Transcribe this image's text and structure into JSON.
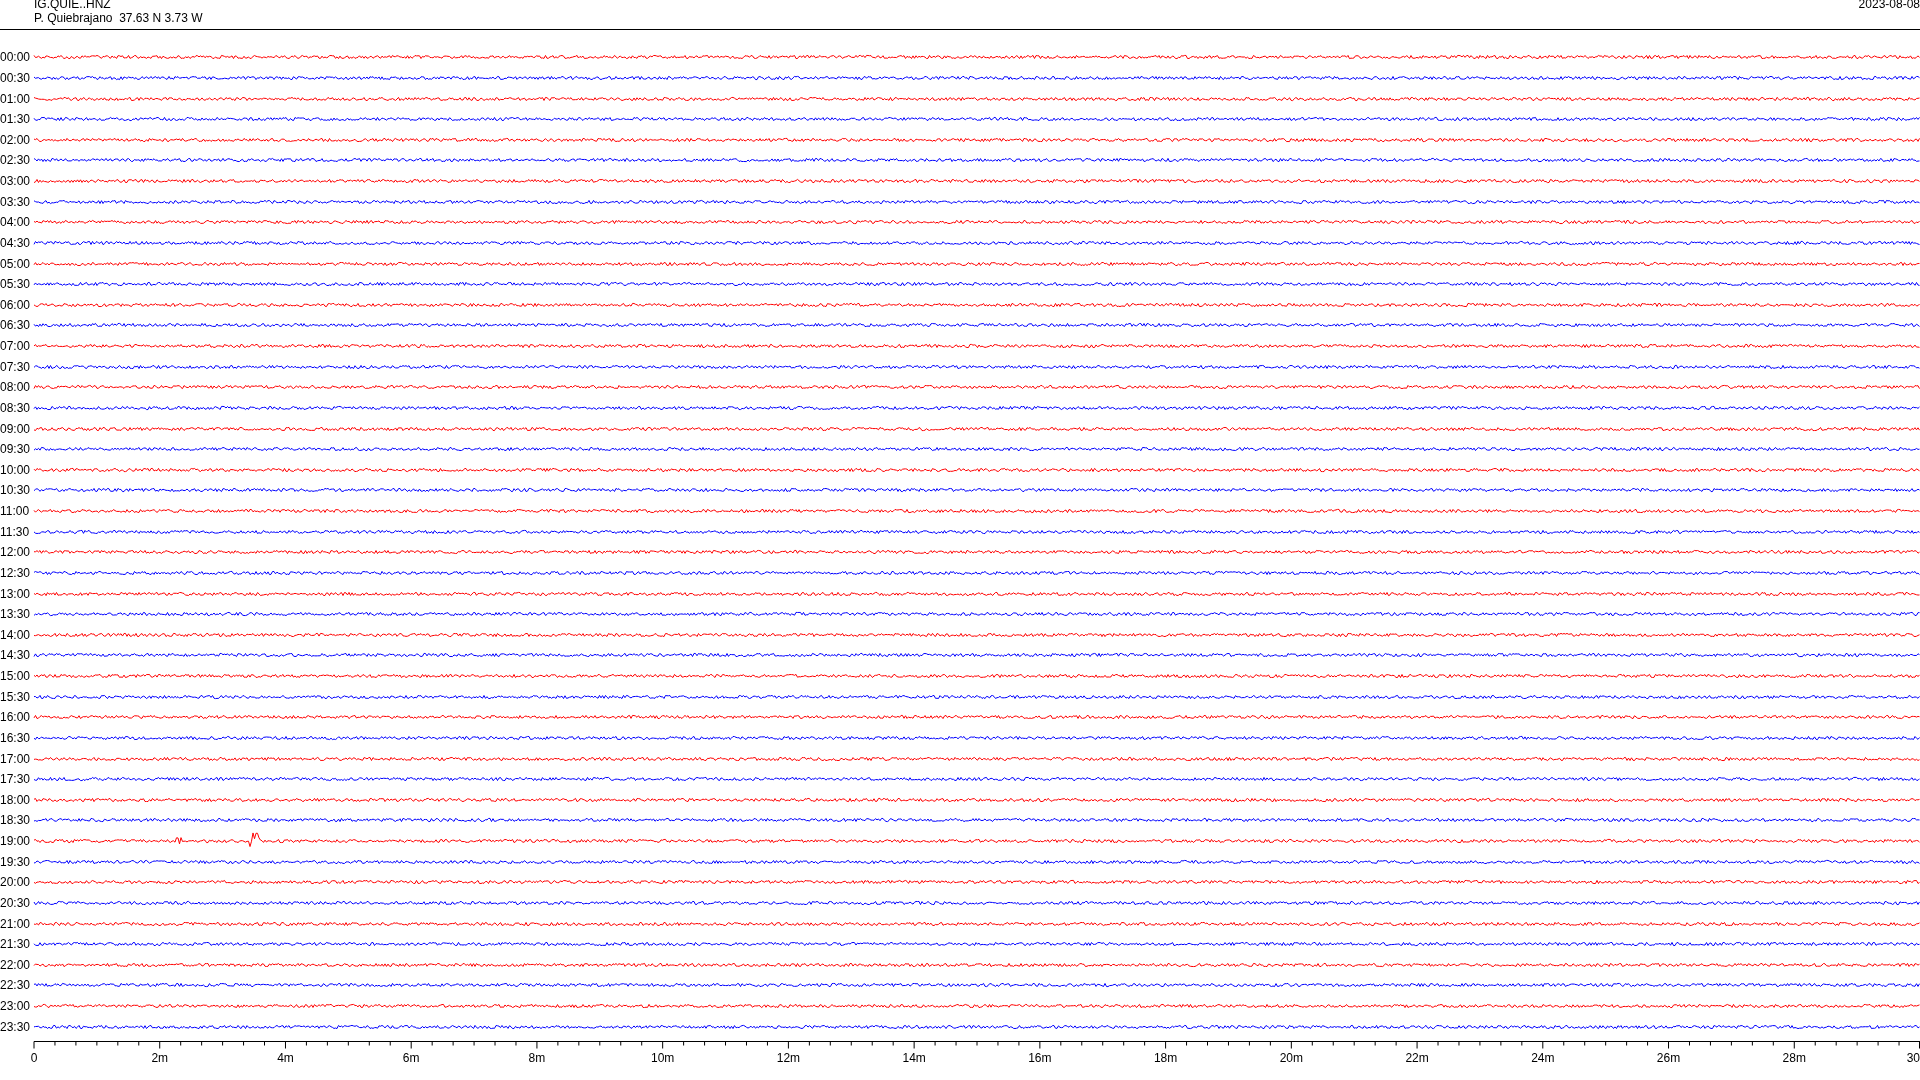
{
  "header": {
    "channel": "IG.QUIE..HNZ",
    "station": "P. Quiebrajano  37.63 N 3.73 W",
    "date": "2023-08-08"
  },
  "traces": [
    {
      "label": "00:00",
      "color": "#ff0000",
      "event": false
    },
    {
      "label": "00:30",
      "color": "#0000ff",
      "event": false
    },
    {
      "label": "01:00",
      "color": "#ff0000",
      "event": false
    },
    {
      "label": "01:30",
      "color": "#0000ff",
      "event": false
    },
    {
      "label": "02:00",
      "color": "#ff0000",
      "event": false
    },
    {
      "label": "02:30",
      "color": "#0000ff",
      "event": false
    },
    {
      "label": "03:00",
      "color": "#ff0000",
      "event": false
    },
    {
      "label": "03:30",
      "color": "#0000ff",
      "event": false
    },
    {
      "label": "04:00",
      "color": "#ff0000",
      "event": false
    },
    {
      "label": "04:30",
      "color": "#0000ff",
      "event": false
    },
    {
      "label": "05:00",
      "color": "#ff0000",
      "event": false
    },
    {
      "label": "05:30",
      "color": "#0000ff",
      "event": false
    },
    {
      "label": "06:00",
      "color": "#ff0000",
      "event": false
    },
    {
      "label": "06:30",
      "color": "#0000ff",
      "event": false
    },
    {
      "label": "07:00",
      "color": "#ff0000",
      "event": false
    },
    {
      "label": "07:30",
      "color": "#0000ff",
      "event": false
    },
    {
      "label": "08:00",
      "color": "#ff0000",
      "event": false
    },
    {
      "label": "08:30",
      "color": "#0000ff",
      "event": false
    },
    {
      "label": "09:00",
      "color": "#ff0000",
      "event": false
    },
    {
      "label": "09:30",
      "color": "#0000ff",
      "event": false
    },
    {
      "label": "10:00",
      "color": "#ff0000",
      "event": false
    },
    {
      "label": "10:30",
      "color": "#0000ff",
      "event": false
    },
    {
      "label": "11:00",
      "color": "#ff0000",
      "event": false
    },
    {
      "label": "11:30",
      "color": "#0000ff",
      "event": false
    },
    {
      "label": "12:00",
      "color": "#ff0000",
      "event": false
    },
    {
      "label": "12:30",
      "color": "#0000ff",
      "event": false
    },
    {
      "label": "13:00",
      "color": "#ff0000",
      "event": false
    },
    {
      "label": "13:30",
      "color": "#0000ff",
      "event": false
    },
    {
      "label": "14:00",
      "color": "#ff0000",
      "event": false
    },
    {
      "label": "14:30",
      "color": "#0000ff",
      "event": false
    },
    {
      "label": "15:00",
      "color": "#ff0000",
      "event": false
    },
    {
      "label": "15:30",
      "color": "#0000ff",
      "event": false
    },
    {
      "label": "16:00",
      "color": "#ff0000",
      "event": false
    },
    {
      "label": "16:30",
      "color": "#0000ff",
      "event": false
    },
    {
      "label": "17:00",
      "color": "#ff0000",
      "event": false
    },
    {
      "label": "17:30",
      "color": "#0000ff",
      "event": false
    },
    {
      "label": "18:00",
      "color": "#ff0000",
      "event": false
    },
    {
      "label": "18:30",
      "color": "#0000ff",
      "event": false
    },
    {
      "label": "19:00",
      "color": "#ff0000",
      "event": true
    },
    {
      "label": "19:30",
      "color": "#0000ff",
      "event": false
    },
    {
      "label": "20:00",
      "color": "#ff0000",
      "event": false
    },
    {
      "label": "20:30",
      "color": "#0000ff",
      "event": false
    },
    {
      "label": "21:00",
      "color": "#ff0000",
      "event": false
    },
    {
      "label": "21:30",
      "color": "#0000ff",
      "event": false
    },
    {
      "label": "22:00",
      "color": "#ff0000",
      "event": false
    },
    {
      "label": "22:30",
      "color": "#0000ff",
      "event": false
    },
    {
      "label": "23:00",
      "color": "#ff0000",
      "event": false
    },
    {
      "label": "23:30",
      "color": "#0000ff",
      "event": false
    }
  ],
  "x_axis": {
    "ticks": [
      "0",
      "2m",
      "4m",
      "6m",
      "8m",
      "10m",
      "12m",
      "14m",
      "16m",
      "18m",
      "20m",
      "22m",
      "24m",
      "26m",
      "28m",
      "30"
    ]
  }
}
